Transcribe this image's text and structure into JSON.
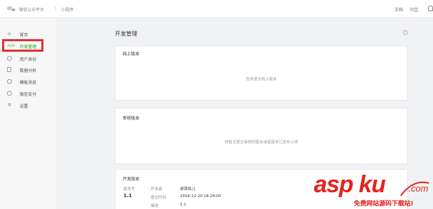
{
  "topbar": {
    "brand": "微信公众平台",
    "separator": "|",
    "product": "小程序",
    "docs": "文档",
    "community": "社区"
  },
  "sidebar": {
    "items": [
      {
        "label": "首页",
        "icon": "home-icon"
      },
      {
        "label": "开发管理",
        "icon": "code-icon",
        "active": true
      },
      {
        "label": "用户身份",
        "icon": "user-icon"
      },
      {
        "label": "数据分析",
        "icon": "analytics-icon"
      },
      {
        "label": "模板消息",
        "icon": "template-icon"
      },
      {
        "label": "微信支付",
        "icon": "pay-icon"
      },
      {
        "label": "设置",
        "icon": "gear-icon"
      }
    ]
  },
  "main": {
    "title": "开发管理",
    "help": "?",
    "online": {
      "title": "线上版本",
      "empty": "尚未提交线上版本"
    },
    "review": {
      "title": "审核版本",
      "empty": "你暂无提交审核的版本或者版本已发布上线"
    },
    "dev": {
      "title": "开发版本",
      "version_label": "版本号",
      "version": "1.1",
      "developer_label": "开发者",
      "developer": "郝霄凯儿",
      "submit_time_label": "提交时间",
      "submit_time": "2016-12-20 18:24:00",
      "desc_label": "描述",
      "desc": "1.1"
    }
  },
  "watermark": {
    "main": "asp ku",
    "domain": ".com",
    "sub": "免费网站源码下载站!"
  },
  "colors": {
    "accent": "#1aad19",
    "highlight": "#e0302f",
    "watermark": "#e8211b"
  }
}
